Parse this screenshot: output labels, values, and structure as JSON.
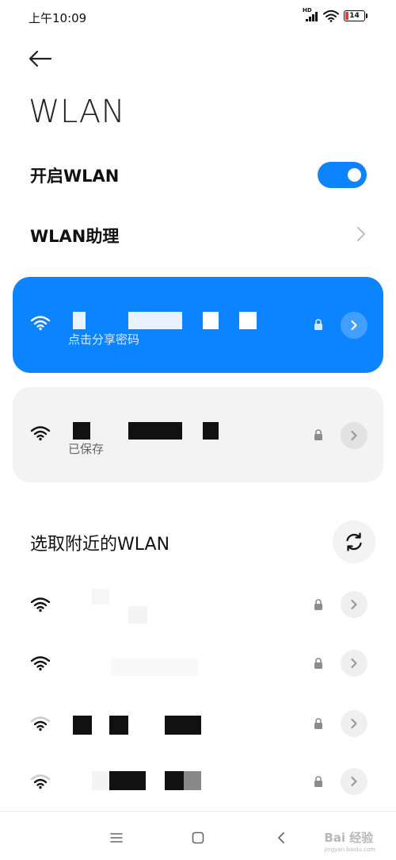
{
  "status_bar": {
    "time": "上午10:09",
    "network_label": "HD",
    "battery_level": "14",
    "icons": [
      "hd-signal-icon",
      "wifi-icon",
      "battery-icon"
    ]
  },
  "header": {
    "back_icon": "arrow-left-icon",
    "title": "WLAN"
  },
  "settings": {
    "enable_label": "开启WLAN",
    "enable_state": true,
    "assistant_label": "WLAN助理"
  },
  "connected_network": {
    "status": "点击分享密码",
    "secured": true
  },
  "saved_network": {
    "status": "已保存",
    "secured": true
  },
  "nearby": {
    "title": "选取附近的WLAN",
    "refresh_icon": "refresh-icon",
    "networks": [
      {
        "signal": "strong",
        "secured": true
      },
      {
        "signal": "strong",
        "secured": true
      },
      {
        "signal": "weak",
        "secured": true
      },
      {
        "signal": "weak",
        "secured": true
      }
    ]
  },
  "nav_bar": {
    "items": [
      "menu-icon",
      "home-icon",
      "back-icon"
    ]
  },
  "watermark": {
    "text": "Bai 经验",
    "sub": "jingyan.baidu.com"
  },
  "colors": {
    "accent": "#0d84ff",
    "card_bg": "#f3f3f3",
    "low_battery": "#e43a3a"
  }
}
